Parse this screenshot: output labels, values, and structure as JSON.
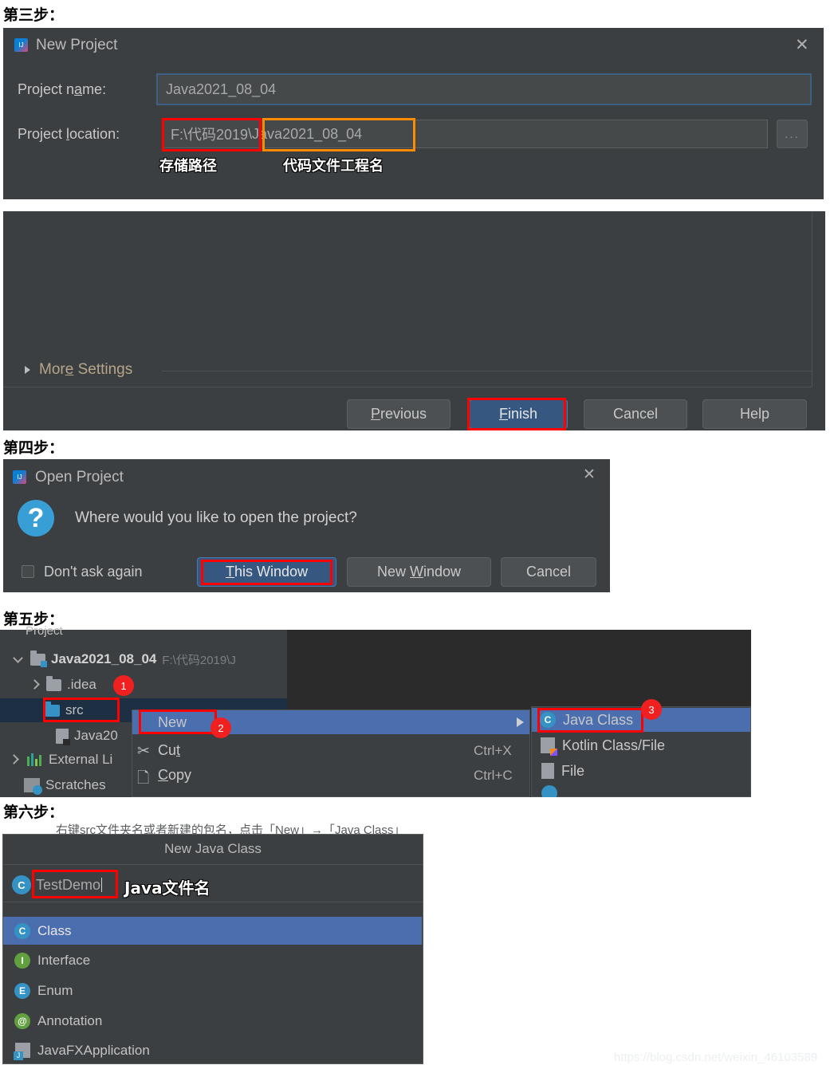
{
  "steps": {
    "step3": "第三步：",
    "step4": "第四步：",
    "step5": "第五步：",
    "step6": "第六步："
  },
  "new_project_dialog": {
    "title": "New Project",
    "close_label": "✕",
    "project_name_label_pre": "Project n",
    "project_name_label_accel": "a",
    "project_name_label_post": "me:",
    "project_name_value": "Java2021_08_04",
    "project_location_label_pre": "Project ",
    "project_location_label_accel": "l",
    "project_location_label_post": "ocation:",
    "project_location_path": "F:\\代码2019",
    "project_location_project": "\\Java2021_08_04",
    "browse_button": "...",
    "annotation_path": "存储路径",
    "annotation_project": "代码文件工程名",
    "more_settings_pre": "Mor",
    "more_settings_accel": "e",
    "more_settings_post": " Settings",
    "buttons": {
      "previous_pre": "",
      "previous_accel": "P",
      "previous_post": "revious",
      "finish_accel": "F",
      "finish_post": "inish",
      "cancel": "Cancel",
      "help": "Help"
    }
  },
  "open_project_dialog": {
    "title": "Open Project",
    "close_label": "✕",
    "icon_glyph": "?",
    "message": "Where would you like to open the project?",
    "dont_ask_again": "Don't ask again",
    "this_window_accel": "T",
    "this_window_post": "his Window",
    "new_window_pre": "New ",
    "new_window_accel": "W",
    "new_window_post": "indow",
    "cancel": "Cancel"
  },
  "project_tree": {
    "toolbar_title": "Project",
    "rows": [
      {
        "label": "Java2021_08_04",
        "sub": "F:\\代码2019\\J"
      },
      {
        "label": ".idea",
        "sub": ""
      },
      {
        "label": "src",
        "sub": ""
      },
      {
        "label": "Java20",
        "sub": ""
      },
      {
        "label": "External Li",
        "sub": ""
      },
      {
        "label": "Scratches ",
        "sub": ""
      }
    ],
    "badges": {
      "one": "1",
      "two": "2",
      "three": "3"
    }
  },
  "context_menu": {
    "items": [
      {
        "label": "New",
        "accel": "",
        "shortcut": ""
      },
      {
        "label_pre": "Cu",
        "accel": "t",
        "label_post": "",
        "shortcut": "Ctrl+X"
      },
      {
        "label_pre": "",
        "accel": "C",
        "label_post": "opy",
        "shortcut": "Ctrl+C"
      }
    ],
    "new_label": "New",
    "cut_pre": "Cu",
    "cut_accel": "t",
    "cut_shortcut": "Ctrl+X",
    "copy_accel": "C",
    "copy_post": "opy",
    "copy_shortcut": "Ctrl+C"
  },
  "new_submenu": {
    "items": [
      {
        "label": "Java Class",
        "icon": "java-class-icon"
      },
      {
        "label": "Kotlin Class/File",
        "icon": "kotlin-icon"
      },
      {
        "label": "File",
        "icon": "file-icon"
      }
    ]
  },
  "new_java_class": {
    "title": "New Java Class",
    "name_value": "TestDemo",
    "annotation": "Java文件名",
    "faint_header": "右键src文件夹名或者新建的包名，点击「New」→「Java Class」",
    "kinds": [
      {
        "label": "Class",
        "icon": "class-icon",
        "selected": true
      },
      {
        "label": "Interface",
        "icon": "interface-icon",
        "selected": false
      },
      {
        "label": "Enum",
        "icon": "enum-icon",
        "selected": false
      },
      {
        "label": "Annotation",
        "icon": "annotation-icon",
        "selected": false
      },
      {
        "label": "JavaFXApplication",
        "icon": "javafx-icon",
        "selected": false
      }
    ]
  },
  "watermark": "https://blog.csdn.net/weixin_46103589",
  "colors": {
    "panel_bg": "#3c3f41",
    "accent_blue": "#365880",
    "highlight_blue": "#4b6eaf",
    "annot_red": "#ff0000",
    "annot_orange": "#ff8c00",
    "badge_red": "#f02020"
  }
}
